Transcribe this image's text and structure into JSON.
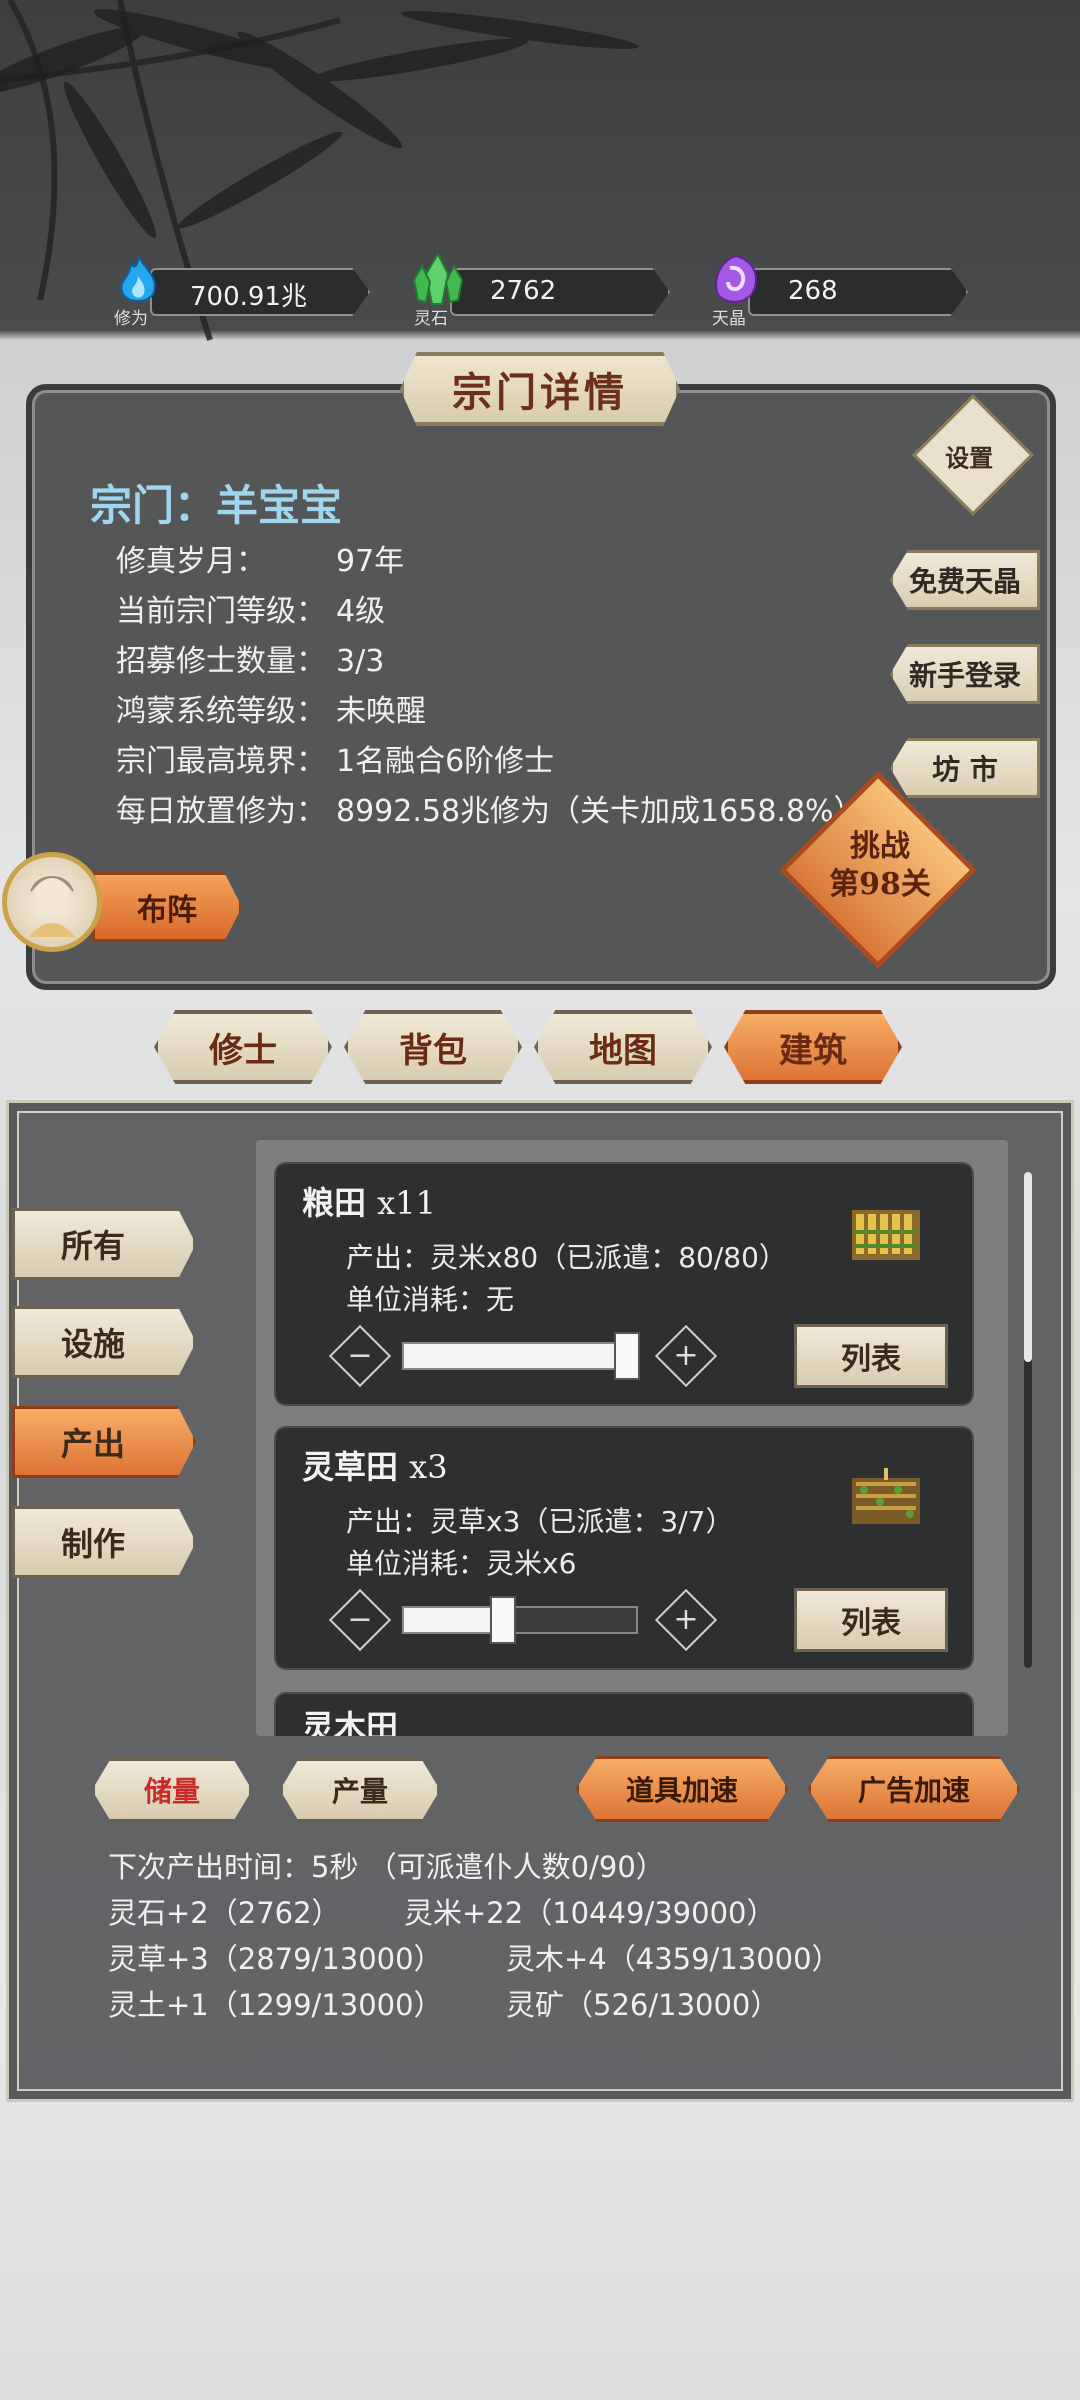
{
  "resources": [
    {
      "icon": "blue-flame-icon",
      "label": "修为",
      "value": "700.91兆"
    },
    {
      "icon": "green-crystal-icon",
      "label": "灵石",
      "value": "2762"
    },
    {
      "icon": "purple-gem-icon",
      "label": "天晶",
      "value": "268"
    }
  ],
  "panel": {
    "title": "宗门详情",
    "sect_name": "宗门：羊宝宝",
    "info": [
      {
        "key": "修真岁月：",
        "value": "97年"
      },
      {
        "key": "当前宗门等级：",
        "value": "4级"
      },
      {
        "key": "招募修士数量：",
        "value": "3/3"
      },
      {
        "key": "鸿蒙系统等级：",
        "value": "未唤醒"
      },
      {
        "key": "宗门最高境界：",
        "value": "1名融合6阶修士"
      },
      {
        "key": "每日放置修为：",
        "value": "8992.58兆修为（关卡加成1658.8%）"
      }
    ],
    "settings": "设置",
    "side_buttons": [
      "免费天晶",
      "新手登录",
      "坊 市"
    ],
    "challenge_line1": "挑战",
    "challenge_line2": "第98关",
    "formation": "布阵"
  },
  "tabs": [
    "修士",
    "背包",
    "地图",
    "建筑"
  ],
  "active_tab": "建筑",
  "categories": [
    "所有",
    "设施",
    "产出",
    "制作"
  ],
  "active_category": "产出",
  "buildings": [
    {
      "name": "粮田",
      "count": "x11",
      "output": "产出：灵米x80（已派遣：80/80）",
      "cost": "单位消耗：无",
      "slider": 1.0,
      "list_label": "列表"
    },
    {
      "name": "灵草田",
      "count": "x3",
      "output": "产出：灵草x3（已派遣：3/7）",
      "cost": "单位消耗：灵米x6",
      "slider": 0.43,
      "list_label": "列表"
    }
  ],
  "partial_card_text": "灵木田",
  "bottom_buttons": {
    "storage": "储量",
    "production": "产量",
    "item_speed": "道具加速",
    "ad_speed": "广告加速"
  },
  "stats": {
    "next_output": "下次产出时间：5秒 （可派遣仆人数0/90）",
    "row1a": "灵石+2（2762）",
    "row1b": "灵米+22（10449/39000）",
    "row2a": "灵草+3（2879/13000）",
    "row2b": "灵木+4（4359/13000）",
    "row3a": "灵土+1（1299/13000）",
    "row3b": "灵矿（526/13000）"
  },
  "colors": {
    "accent_orange": "#dd7436",
    "parchment": "#efe6cf",
    "sect_name": "#9fd7ef",
    "red_text": "#c92a2a"
  }
}
